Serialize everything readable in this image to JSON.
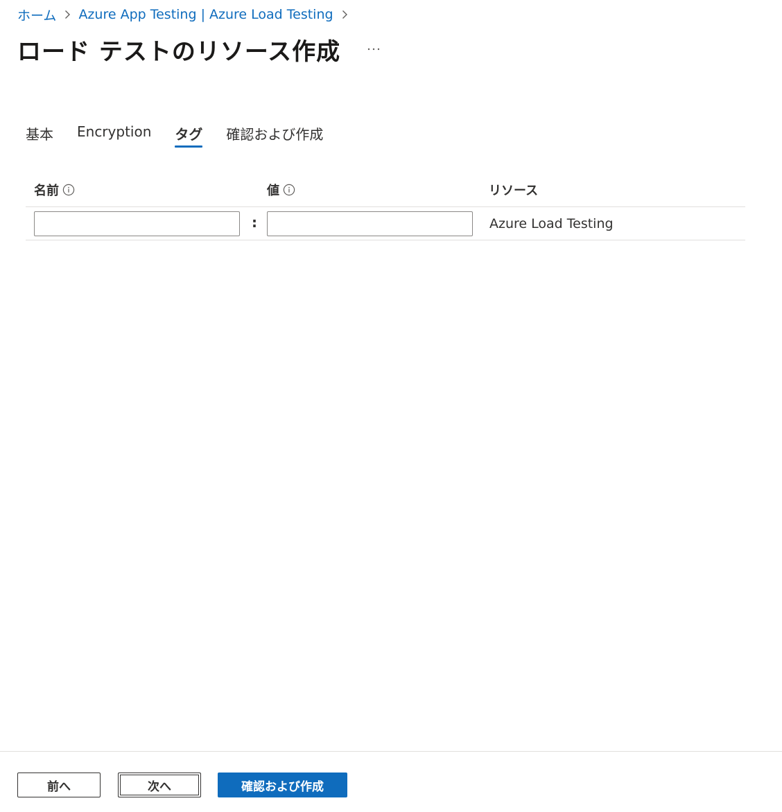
{
  "breadcrumb": {
    "items": [
      {
        "label": "ホーム"
      },
      {
        "label": "Azure App Testing | Azure Load Testing"
      }
    ]
  },
  "page": {
    "title": "ロード テストのリソース作成",
    "more_icon": "more-horizontal-icon"
  },
  "tabs": [
    {
      "label": "基本",
      "active": false
    },
    {
      "label": "Encryption",
      "active": false
    },
    {
      "label": "タグ",
      "active": true
    },
    {
      "label": "確認および作成",
      "active": false
    }
  ],
  "grid": {
    "headers": {
      "name": "名前",
      "value": "値",
      "resource": "リソース"
    },
    "info_icon": "info-circle-icon",
    "rows": [
      {
        "name": "",
        "value": "",
        "separator": ":",
        "resource": "Azure Load Testing"
      }
    ]
  },
  "footer": {
    "prev_label": "前へ",
    "next_label": "次へ",
    "review_label": "確認および作成"
  },
  "colors": {
    "accent": "#0f6cbd",
    "text": "#323130",
    "border": "#8a8886",
    "divider": "#e1dfdd"
  }
}
